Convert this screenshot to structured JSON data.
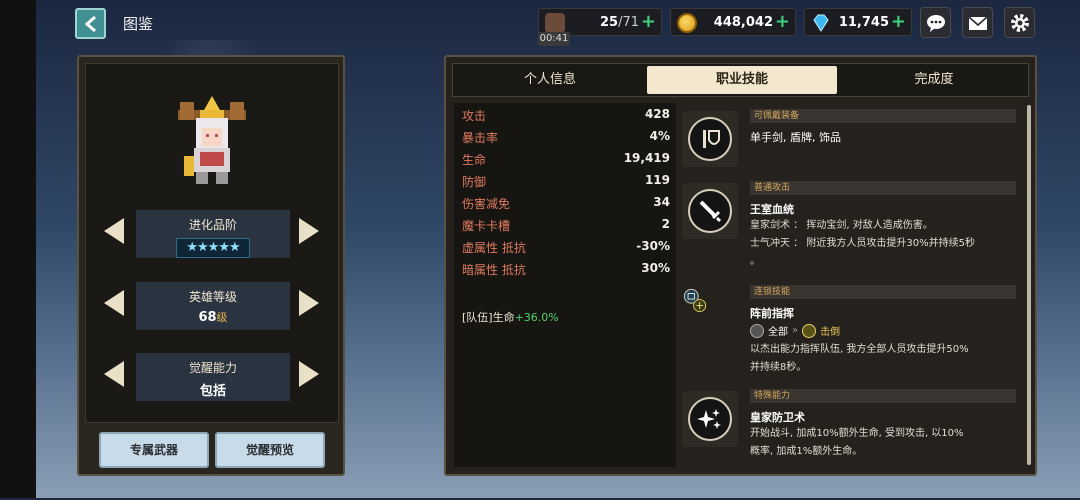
{
  "header": {
    "title": "图鉴",
    "stamina": "25",
    "stamina_max": "/71",
    "stamina_timer": "00:41",
    "gold": "448,042",
    "gems": "11,745"
  },
  "hero": {
    "evolution_label": "进化品阶",
    "evolution_stars": "★★★★★",
    "level_label": "英雄等级",
    "level_value": "68",
    "level_unit": "级",
    "awaken_label": "觉醒能力",
    "awaken_value": "包括",
    "exclusive_weapon_button": "专属武器",
    "awaken_preview_button": "觉醒预览"
  },
  "tabs": [
    "个人信息",
    "职业技能",
    "完成度"
  ],
  "active_tab": 1,
  "stats": [
    {
      "k": "攻击",
      "v": "428"
    },
    {
      "k": "暴击率",
      "v": "4%"
    },
    {
      "k": "生命",
      "v": "19,419"
    },
    {
      "k": "防御",
      "v": "119"
    },
    {
      "k": "伤害减免",
      "v": "34"
    },
    {
      "k": "魔卡卡槽",
      "v": "2"
    },
    {
      "k": "虚属性 抵抗",
      "v": "-30%"
    },
    {
      "k": "暗属性 抵抗",
      "v": "30%"
    }
  ],
  "team_bonus": {
    "prefix": "[队伍]生命",
    "value": "+36.0%"
  },
  "skills": [
    {
      "category": "可佩戴装备",
      "name": "单手剑, 盾牌, 饰品",
      "icon": "shield-sword-icon"
    },
    {
      "category": "普通攻击",
      "name": "王室血统",
      "icon": "sword-icon",
      "lines": [
        "皇家剑术 ： 挥动宝剑, 对敌人造成伤害。",
        "士气冲天 ： 附近我方人员攻击提升30%并持续5秒",
        "。"
      ]
    },
    {
      "category": "连锁技能",
      "name": "阵前指挥",
      "icon": "command-icon",
      "chain_from": "全部",
      "chain_to": "击倒",
      "lines": [
        "以杰出能力指挥队伍, 我方全部人员攻击提升50%",
        "并持续8秒。"
      ]
    },
    {
      "category": "特殊能力",
      "name": "皇家防卫术",
      "icon": "sparkle-icon",
      "lines": [
        "开始战斗, 加成10%额外生命, 受到攻击, 以10%",
        "概率, 加成1%额外生命。"
      ]
    }
  ]
}
